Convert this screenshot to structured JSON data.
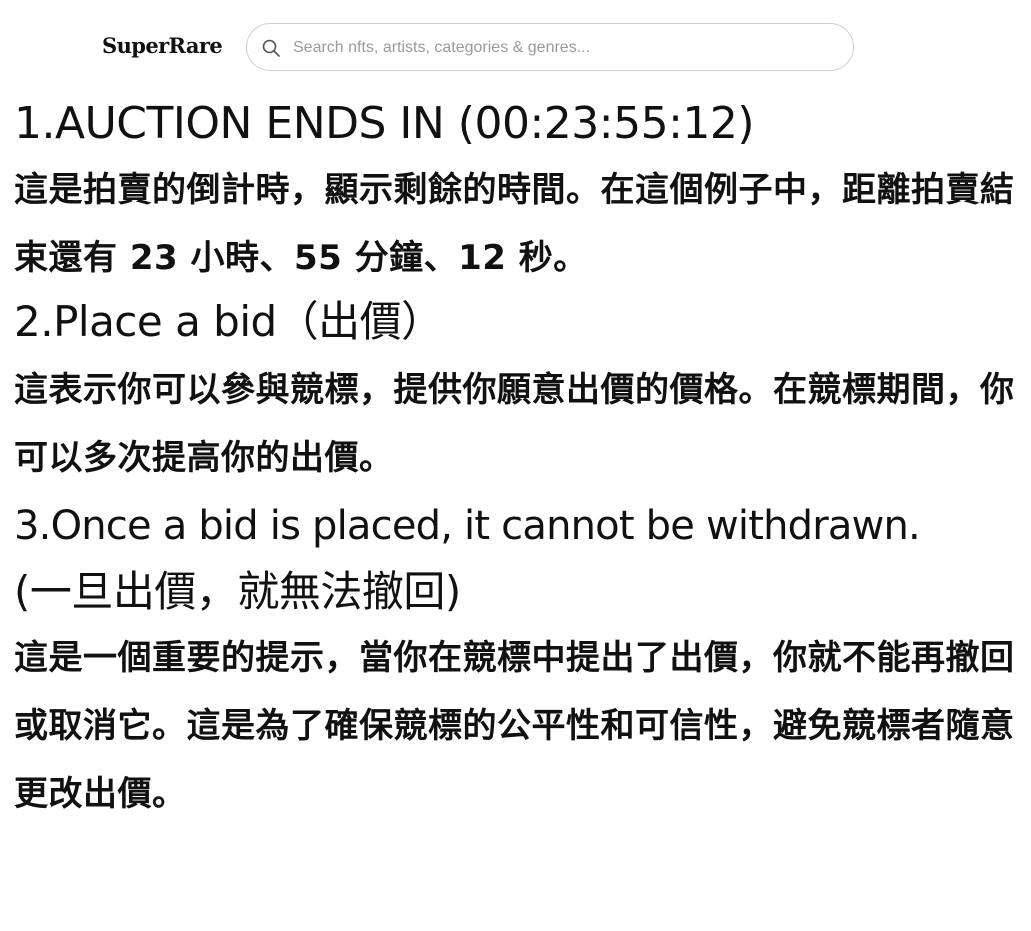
{
  "header": {
    "logo": "SuperRare",
    "search_placeholder": "Search nfts, artists, categories & genres..."
  },
  "sections": [
    {
      "heading": "1.AUCTION ENDS IN (00:23:55:12)",
      "body": "這是拍賣的倒計時，顯示剩餘的時間。在這個例子中，距離拍賣結束還有 23 小時、55 分鐘、12 秒。"
    },
    {
      "heading": "2.Place a bid（出價）",
      "body": "這表示你可以參與競標，提供你願意出價的價格。在競標期間，你可以多次提高你的出價。"
    },
    {
      "heading": "3.Once a bid is placed, it cannot be withdrawn.",
      "subheading": "(一旦出價，就無法撤回)",
      "body": "這是一個重要的提示，當你在競標中提出了出價，你就不能再撤回或取消它。這是為了確保競標的公平性和可信性，避免競標者隨意更改出價。"
    }
  ]
}
